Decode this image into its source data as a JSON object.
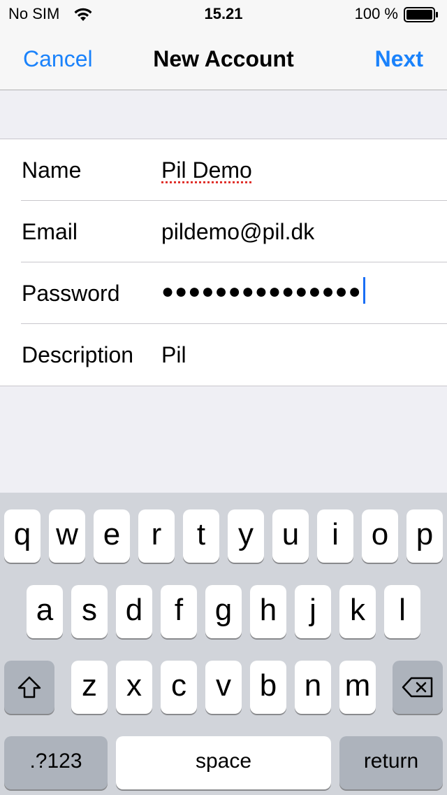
{
  "status_bar": {
    "carrier": "No SIM",
    "time": "15.21",
    "battery_percent": "100 %",
    "wifi_icon": "wifi-icon",
    "battery_icon": "battery-icon"
  },
  "nav": {
    "cancel": "Cancel",
    "title": "New Account",
    "next": "Next",
    "accent_color": "#1a82fb"
  },
  "form": {
    "name": {
      "label": "Name",
      "value": "Pil Demo"
    },
    "email": {
      "label": "Email",
      "value": "pildemo@pil.dk"
    },
    "password": {
      "label": "Password",
      "value": "●●●●●●●●●●●●●●●"
    },
    "description": {
      "label": "Description",
      "value": "Pil"
    }
  },
  "keyboard": {
    "row1": [
      "q",
      "w",
      "e",
      "r",
      "t",
      "y",
      "u",
      "i",
      "o",
      "p"
    ],
    "row2": [
      "a",
      "s",
      "d",
      "f",
      "g",
      "h",
      "j",
      "k",
      "l"
    ],
    "row3": [
      "z",
      "x",
      "c",
      "v",
      "b",
      "n",
      "m"
    ],
    "shift_icon": "shift-icon",
    "delete_icon": "delete-icon",
    "numbers": ".?123",
    "space": "space",
    "return": "return"
  }
}
